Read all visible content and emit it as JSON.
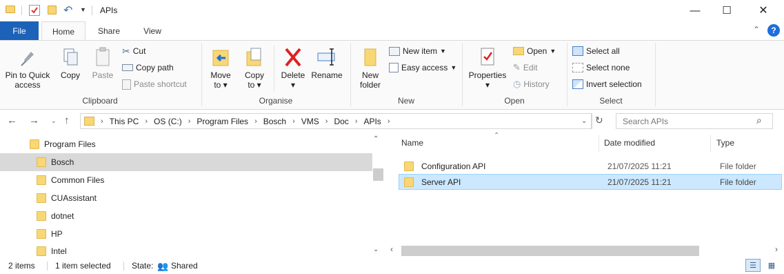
{
  "window": {
    "title": "APIs",
    "minimize_glyph": "—",
    "maximize_glyph": "☐",
    "close_glyph": "✕"
  },
  "tabs": [
    "File",
    "Home",
    "Share",
    "View"
  ],
  "ribbon": {
    "clipboard": {
      "label": "Clipboard",
      "pin": "Pin to Quick",
      "pin2": "access",
      "copy": "Copy",
      "paste": "Paste",
      "cut": "Cut",
      "copy_path": "Copy path",
      "paste_shortcut": "Paste shortcut"
    },
    "organise": {
      "label": "Organise",
      "move": "Move",
      "move2": "to",
      "copy": "Copy",
      "copy2": "to",
      "delete": "Delete",
      "rename": "Rename"
    },
    "new": {
      "label": "New",
      "new_folder": "New",
      "new_folder2": "folder",
      "new_item": "New item",
      "easy_access": "Easy access"
    },
    "open": {
      "label": "Open",
      "properties": "Properties",
      "open": "Open",
      "edit": "Edit",
      "history": "History"
    },
    "select": {
      "label": "Select",
      "select_all": "Select all",
      "select_none": "Select none",
      "invert": "Invert selection"
    }
  },
  "address": {
    "crumbs": [
      "This PC",
      "OS (C:)",
      "Program Files",
      "Bosch",
      "VMS",
      "Doc",
      "APIs"
    ],
    "search_placeholder": "Search APIs"
  },
  "tree": {
    "root": "Program Files",
    "items": [
      "Bosch",
      "Common Files",
      "CUAssistant",
      "dotnet",
      "HP",
      "Intel"
    ]
  },
  "files": {
    "headers": {
      "name": "Name",
      "date": "Date modified",
      "type": "Type"
    },
    "rows": [
      {
        "name": "Configuration API",
        "date": "21/07/2025 11:21",
        "type": "File folder"
      },
      {
        "name": "Server API",
        "date": "21/07/2025 11:21",
        "type": "File folder"
      }
    ]
  },
  "status": {
    "count": "2 items",
    "selected": "1 item selected",
    "state_label": "State:",
    "state_value": "Shared"
  },
  "colors": {
    "accent": "#1c62b8",
    "folder": "#f8d775",
    "selection": "#cce8ff",
    "help": "#1e6fd9"
  }
}
